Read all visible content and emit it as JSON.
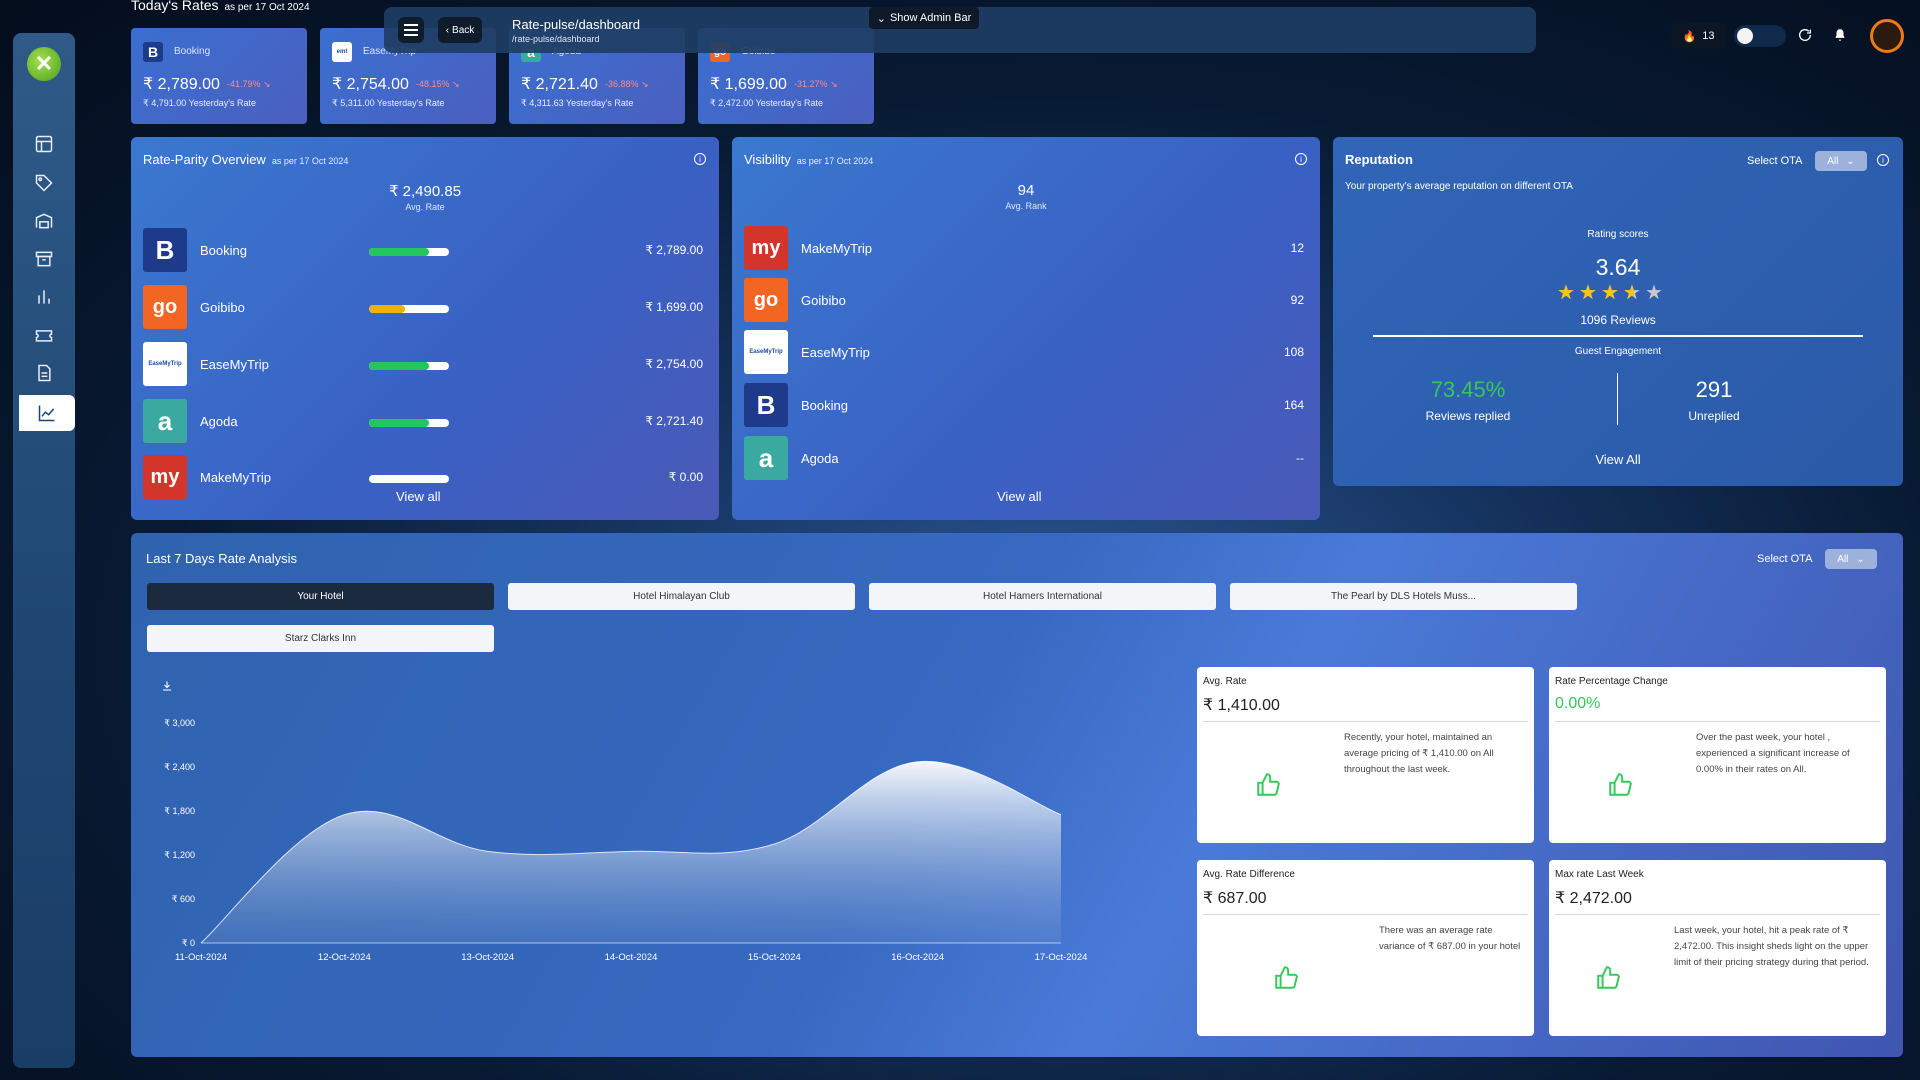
{
  "header": {
    "title": "Rate-pulse/dashboard",
    "path": "/rate-pulse/dashboard",
    "back_label": "Back",
    "admin_bar_label": "Show Admin Bar",
    "streak_count": "13"
  },
  "todays_rates": {
    "title": "Today's Rates",
    "subtitle": "as per 17 Oct 2024",
    "cards": [
      {
        "ota": "Booking",
        "price": "₹ 2,789.00",
        "pct": "-41.79%",
        "yesterday": "₹ 4,791.00 Yesterday's Rate",
        "logo_letter": "B",
        "logo_color": "#1e3a8a"
      },
      {
        "ota": "EaseMyTrip",
        "price": "₹ 2,754.00",
        "pct": "-48.15%",
        "yesterday": "₹ 5,311.00 Yesterday's Rate",
        "logo_letter": "e",
        "logo_color": "#ffffff"
      },
      {
        "ota": "Agoda",
        "price": "₹ 2,721.40",
        "pct": "-36.88%",
        "yesterday": "₹ 4,311.63 Yesterday's Rate",
        "logo_letter": "a",
        "logo_color": "#3aa9a0"
      },
      {
        "ota": "Goibibo",
        "price": "₹ 1,699.00",
        "pct": "-31.27%",
        "yesterday": "₹ 2,472.00 Yesterday's Rate",
        "logo_letter": "go",
        "logo_color": "#f26522"
      }
    ]
  },
  "rate_parity": {
    "title": "Rate-Parity Overview",
    "subtitle": "as per 17 Oct 2024",
    "avg_value": "₹ 2,490.85",
    "avg_label": "Avg. Rate",
    "view_all": "View all",
    "rows": [
      {
        "name": "Booking",
        "value": "₹ 2,789.00",
        "fill": 0.75,
        "bar_color": "#22c55e",
        "logo_text": "B",
        "logo_bg": "#1e3a8a",
        "logo_fg": "#ffffff"
      },
      {
        "name": "Goibibo",
        "value": "₹ 1,699.00",
        "fill": 0.45,
        "bar_color": "#eab308",
        "logo_text": "go",
        "logo_bg": "#f26522",
        "logo_fg": "#ffffff"
      },
      {
        "name": "EaseMyTrip",
        "value": "₹ 2,754.00",
        "fill": 0.75,
        "bar_color": "#22c55e",
        "logo_text": "EaseMyTrip",
        "logo_bg": "#ffffff",
        "logo_fg": "#1b4fa0"
      },
      {
        "name": "Agoda",
        "value": "₹ 2,721.40",
        "fill": 0.75,
        "bar_color": "#22c55e",
        "logo_text": "a",
        "logo_bg": "#3aa9a0",
        "logo_fg": "#ffffff"
      },
      {
        "name": "MakeMyTrip",
        "value": "₹ 0.00",
        "fill": 0.0,
        "bar_color": "#22c55e",
        "logo_text": "my",
        "logo_bg": "#d3352a",
        "logo_fg": "#ffffff"
      }
    ]
  },
  "visibility": {
    "title": "Visibility",
    "subtitle": "as per 17 Oct 2024",
    "avg_value": "94",
    "avg_label": "Avg. Rank",
    "view_all": "View all",
    "rows": [
      {
        "name": "MakeMyTrip",
        "value": "12",
        "logo_text": "my",
        "logo_bg": "#d3352a",
        "logo_fg": "#ffffff"
      },
      {
        "name": "Goibibo",
        "value": "92",
        "logo_text": "go",
        "logo_bg": "#f26522",
        "logo_fg": "#ffffff"
      },
      {
        "name": "EaseMyTrip",
        "value": "108",
        "logo_text": "EaseMyTrip",
        "logo_bg": "#ffffff",
        "logo_fg": "#1b4fa0"
      },
      {
        "name": "Booking",
        "value": "164",
        "logo_text": "B",
        "logo_bg": "#1e3a8a",
        "logo_fg": "#ffffff"
      },
      {
        "name": "Agoda",
        "value": "--",
        "logo_text": "a",
        "logo_bg": "#3aa9a0",
        "logo_fg": "#ffffff"
      }
    ]
  },
  "reputation": {
    "title": "Reputation",
    "select_label": "Select OTA",
    "select_value": "All",
    "subtitle": "Your property's average reputation on different OTA",
    "rating_label": "Rating scores",
    "rating": "3.64",
    "rating_stars": 3.64,
    "reviews": "1096 Reviews",
    "engagement_label": "Guest Engagement",
    "replied_pct": "73.45%",
    "replied_label": "Reviews replied",
    "unreplied": "291",
    "unreplied_label": "Unreplied",
    "view_all": "View All"
  },
  "analysis": {
    "title": "Last 7 Days Rate Analysis",
    "select_label": "Select OTA",
    "select_value": "All",
    "tabs": [
      "Your Hotel",
      "Hotel Himalayan Club",
      "Hotel Hamers International",
      "The Pearl by DLS Hotels Muss...",
      "Starz Clarks Inn"
    ],
    "insights": [
      {
        "title": "Avg. Rate",
        "value": "₹ 1,410.00",
        "desc": "Recently, your hotel, maintained an average pricing of ₹ 1,410.00 on All throughout the last week."
      },
      {
        "title": "Rate Percentage Change",
        "value": "0.00%",
        "desc": "Over the past week, your hotel , experienced a significant increase of 0.00% in their rates on All."
      },
      {
        "title": "Avg. Rate Difference",
        "value": "₹ 687.00",
        "desc": "There was an average rate variance of ₹ 687.00 in your hotel"
      },
      {
        "title": "Max rate Last Week",
        "value": "₹ 2,472.00",
        "desc": "Last week, your hotel, hit a peak rate of ₹ 2,472.00. This insight sheds light on the upper limit of their pricing strategy during that period."
      }
    ]
  },
  "chart_data": {
    "type": "area",
    "x": [
      "11-Oct-2024",
      "12-Oct-2024",
      "13-Oct-2024",
      "14-Oct-2024",
      "15-Oct-2024",
      "16-Oct-2024",
      "17-Oct-2024"
    ],
    "values": [
      0,
      1750,
      1250,
      1250,
      1350,
      2472,
      1750
    ],
    "yticks": [
      "₹ 0",
      "₹ 600",
      "₹ 1,200",
      "₹ 1,800",
      "₹ 2,400",
      "₹ 3,000"
    ],
    "ylim": [
      0,
      3000
    ],
    "colors": {
      "fill_top": "#ffffff",
      "fill_bottom": "#6f93c9",
      "line": "#ffffff"
    }
  }
}
